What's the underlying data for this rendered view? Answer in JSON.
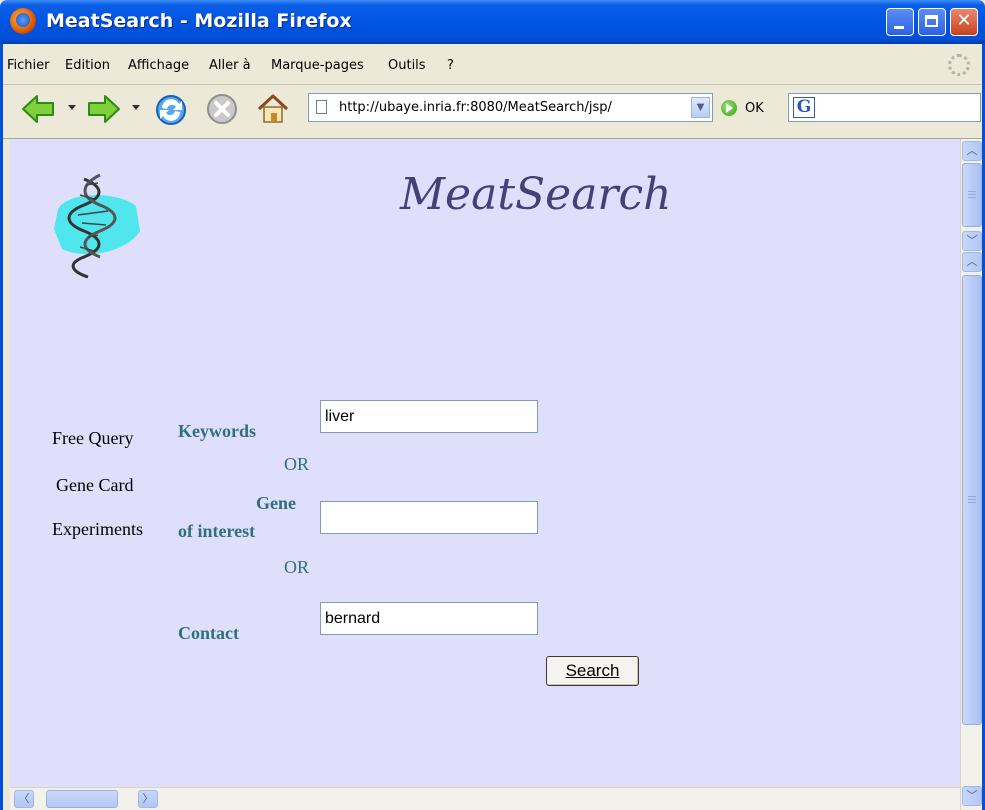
{
  "window": {
    "title": "MeatSearch - Mozilla Firefox"
  },
  "menubar": {
    "items": [
      "Fichier",
      "Edition",
      "Affichage",
      "Aller à",
      "Marque-pages",
      "Outils",
      "?"
    ]
  },
  "navbar": {
    "url": "http://ubaye.inria.fr:8080/MeatSearch/jsp/",
    "go_label": "OK",
    "search_engine_letter": "G"
  },
  "page": {
    "title": "MeatSearch",
    "side_links": [
      "Free Query",
      "Gene Card",
      "Experiments"
    ],
    "form": {
      "keywords_label": "Keywords",
      "keywords_value": "liver",
      "or_1": "OR",
      "gene_label_line1": "Gene",
      "gene_label_line2": "of interest",
      "gene_value": "",
      "or_2": "OR",
      "contact_label": "Contact",
      "contact_value": "bernard",
      "search_button": "Search"
    }
  },
  "icons": [
    "back-arrow-icon",
    "forward-arrow-icon",
    "reload-icon",
    "stop-icon",
    "home-icon",
    "page-icon",
    "go-icon",
    "throbber-icon",
    "dna-logo-icon"
  ]
}
